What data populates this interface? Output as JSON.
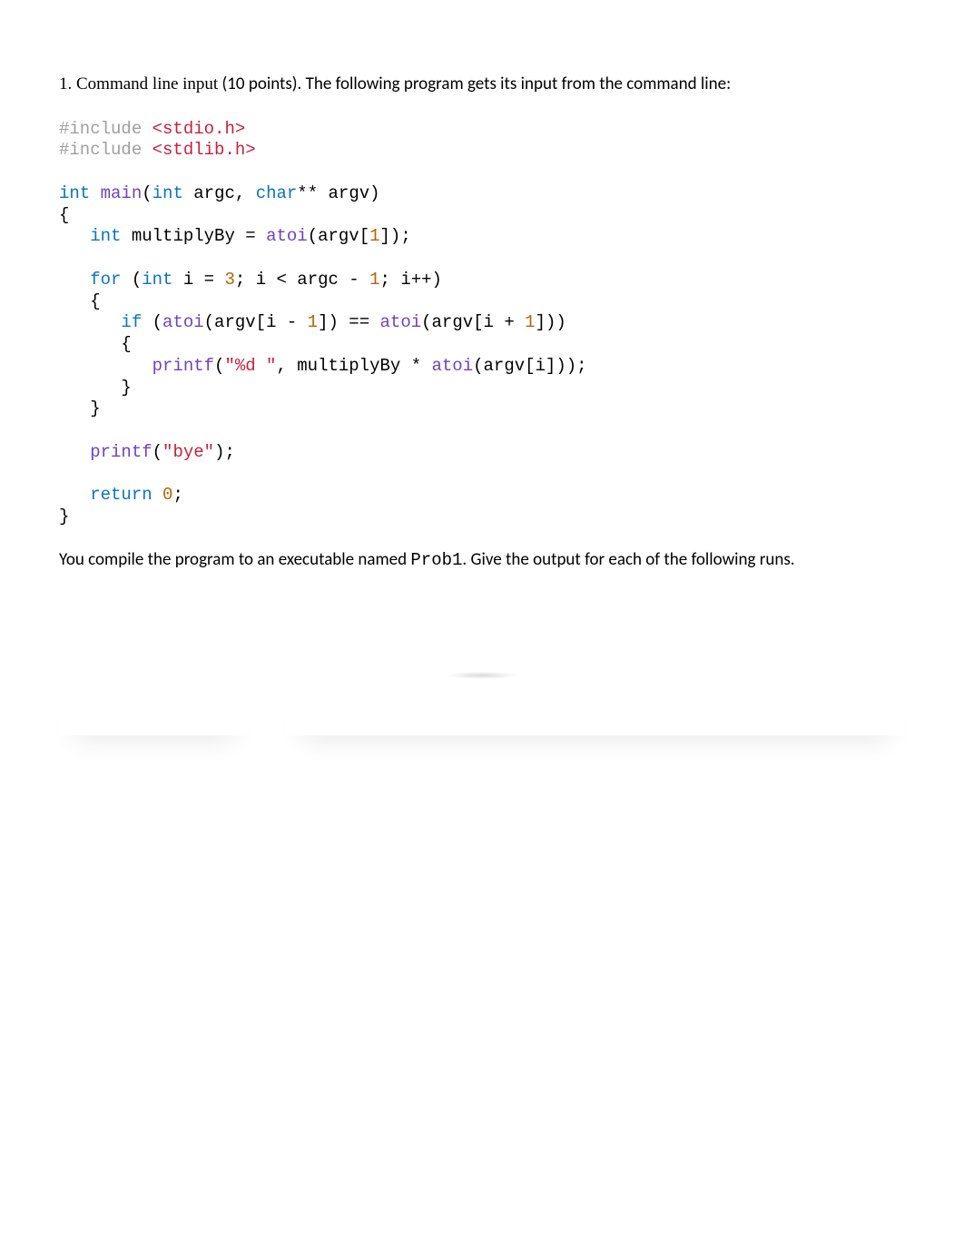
{
  "question": {
    "number_prefix": "1.",
    "title_serif": "Command line input",
    "points_sans": "  (10 points). The following program gets its input from the command line:"
  },
  "code": {
    "lines": {
      "l1_pre_kw": "#include",
      "l1_pre_sp": " ",
      "l1_pre_hdr": "<stdio.h>",
      "l2_pre_kw": "#include",
      "l2_pre_sp": " ",
      "l2_pre_hdr": "<stdlib.h>",
      "blank1": "",
      "l3_type1": "int",
      "l3_sp1": " ",
      "l3_func": "main",
      "l3_open": "(",
      "l3_type2": "int",
      "l3_sp2": " ",
      "l3_arg1": "argc",
      "l3_comma": ", ",
      "l3_type3": "char",
      "l3_stars": "** ",
      "l3_arg2": "argv",
      "l3_close": ")",
      "l4": "{",
      "l5_indent": "   ",
      "l5_type": "int",
      "l5_sp": " ",
      "l5_id": "multiplyBy = ",
      "l5_fn": "atoi",
      "l5_op": "(argv[",
      "l5_num": "1",
      "l5_cl": "]);",
      "blank2": "",
      "l6_indent": "   ",
      "l6_for": "for",
      "l6_sp": " (",
      "l6_type": "int",
      "l6_sp2": " i = ",
      "l6_n1": "3",
      "l6_mid": "; i < argc - ",
      "l6_n2": "1",
      "l6_end": "; i++)",
      "l7": "   {",
      "l8_indent": "      ",
      "l8_if": "if",
      "l8_sp": " (",
      "l8_fn1": "atoi",
      "l8_a": "(argv[i - ",
      "l8_n1": "1",
      "l8_b": "]) == ",
      "l8_fn2": "atoi",
      "l8_c": "(argv[i + ",
      "l8_n2": "1",
      "l8_d": "]))",
      "l9": "      {",
      "l10_indent": "         ",
      "l10_fn": "printf",
      "l10_op": "(",
      "l10_str": "\"%d \"",
      "l10_mid": ", multiplyBy * ",
      "l10_fn2": "atoi",
      "l10_end": "(argv[i]));",
      "l11": "      }",
      "l12": "   }",
      "blank3": "",
      "l13_indent": "   ",
      "l13_fn": "printf",
      "l13_op": "(",
      "l13_str": "\"bye\"",
      "l13_cl": ");",
      "blank4": "",
      "l14_indent": "   ",
      "l14_ret": "return",
      "l14_sp": " ",
      "l14_n": "0",
      "l14_sc": ";",
      "l15": "}"
    }
  },
  "after": {
    "part1": "You compile the program to an executable named ",
    "mono": "Prob1",
    "part2": ". Give the output for each of the following runs."
  }
}
